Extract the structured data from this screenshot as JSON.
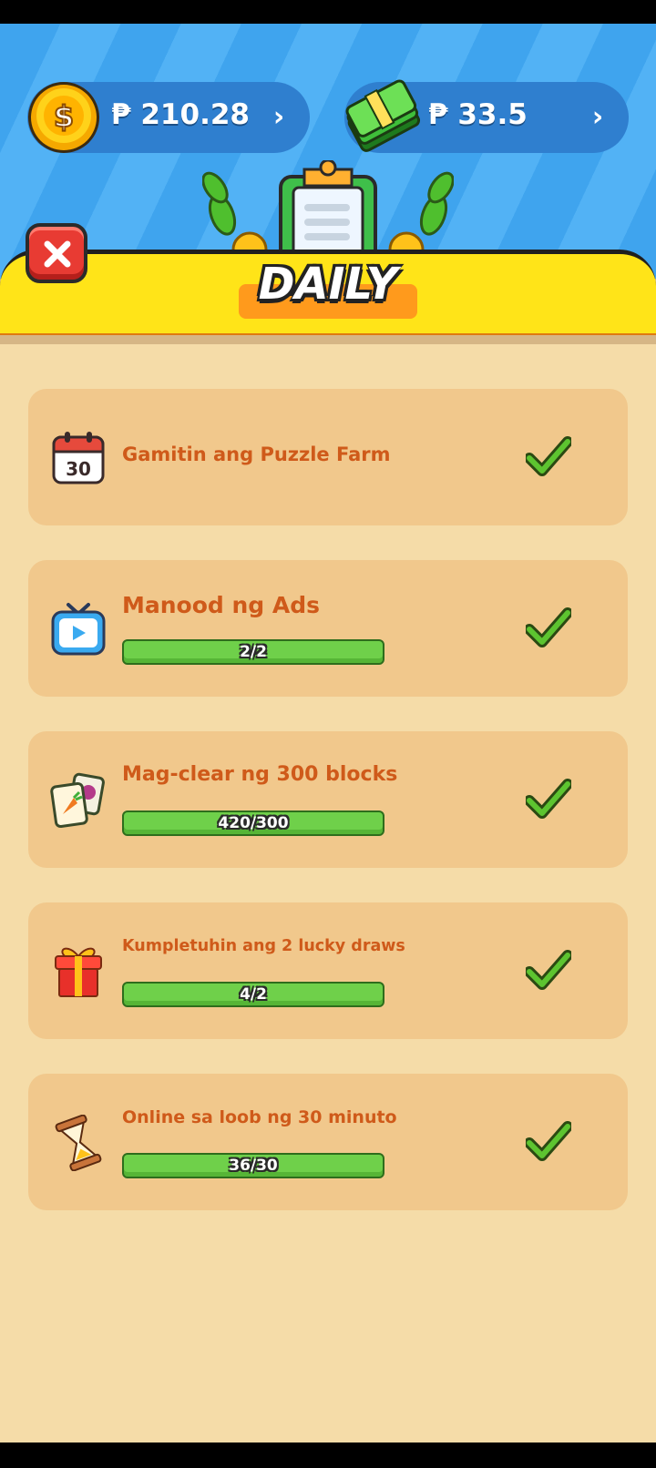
{
  "header": {
    "coins_value": "₱ 210.28",
    "cash_value": "₱ 33.5",
    "arrow_glyph": "›"
  },
  "banner": {
    "title": "DAILY"
  },
  "tasks": [
    {
      "title": "Gamitin ang Puzzle Farm",
      "icon": "calendar-icon",
      "calendar_day": "30",
      "progress_text": "",
      "completed": true
    },
    {
      "title": "Manood ng Ads",
      "icon": "tv-play-icon",
      "progress_text": "2/2",
      "completed": true
    },
    {
      "title": "Mag-clear ng 300 blocks",
      "icon": "tile-blocks-icon",
      "progress_text": "420/300",
      "completed": true
    },
    {
      "title": "Kumpletuhin ang 2 lucky draws",
      "icon": "gift-icon",
      "progress_text": "4/2",
      "completed": true
    },
    {
      "title": "Online sa loob ng 30 minuto",
      "icon": "hourglass-icon",
      "progress_text": "36/30",
      "completed": true
    }
  ],
  "colors": {
    "background": "#f5dca8",
    "card": "#f1c88c",
    "task_title": "#cf5a1a",
    "progress_fill": "#6fd04a",
    "banner": "#ffe418",
    "header_blue": "#3fa4ee",
    "close_red": "#e83b33",
    "check_green": "#5dc430"
  }
}
